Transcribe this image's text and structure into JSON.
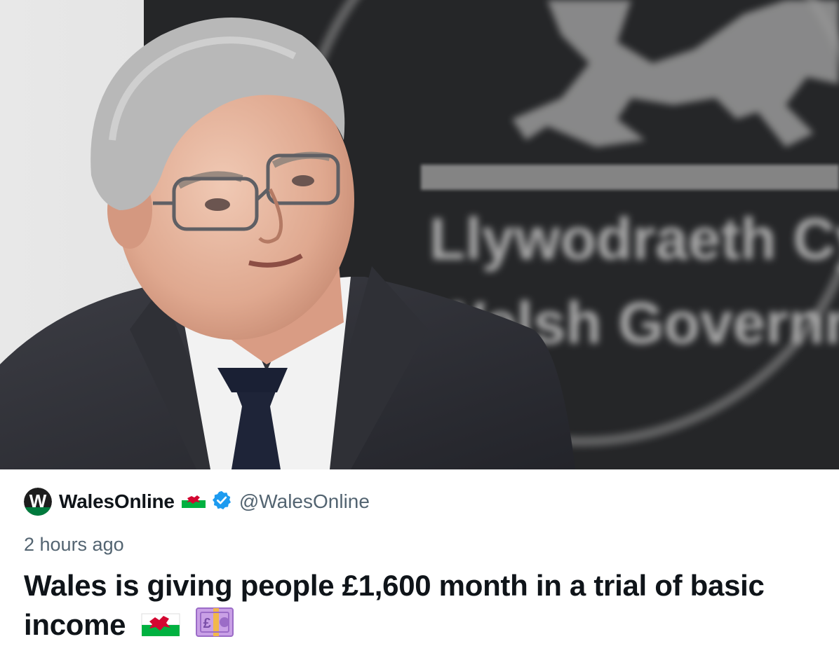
{
  "tweet": {
    "author_name": "WalesOnline",
    "author_handle": "@WalesOnline",
    "avatar_letter": "W",
    "timestamp": "2 hours ago",
    "headline": "Wales is giving people £1,600 month in a trial of basic income",
    "emojis": [
      "flag-wales-icon",
      "pound-banknote-icon"
    ]
  },
  "photo": {
    "backdrop_text_line1": "Llywodraeth Cy",
    "backdrop_text_line2": "Welsh Governm"
  },
  "colors": {
    "verified": "#1d9bf0",
    "text_primary": "#0f1419",
    "text_secondary": "#536471",
    "wales_red": "#d30731",
    "wales_green": "#00b140"
  }
}
